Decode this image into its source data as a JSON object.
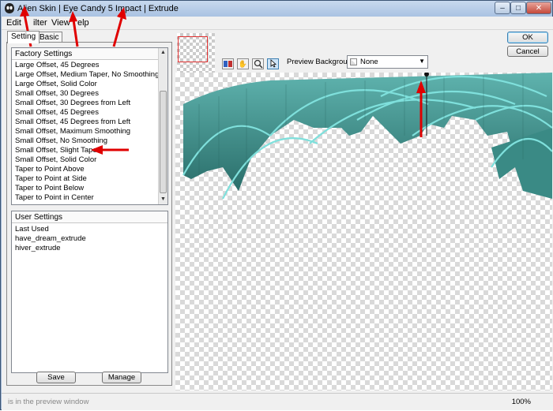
{
  "window": {
    "title": "Alien Skin | Eye Candy 5 Impact | Extrude",
    "controls": {
      "minimize": "–",
      "maximize": "□",
      "close": "✕"
    }
  },
  "menu": {
    "items": [
      {
        "label": "Edit"
      },
      {
        "label": "ilter"
      },
      {
        "label": "View"
      },
      {
        "label": "elp"
      }
    ]
  },
  "tabs": {
    "settings": "Setting",
    "basic": "Basic"
  },
  "factory": {
    "header": "Factory Settings",
    "items": [
      "Large Offset, 45 Degrees",
      "Large Offset, Medium Taper, No Smoothing",
      "Large Offset, Solid Color",
      "Small Offset, 30 Degrees",
      "Small Offset, 30 Degrees from Left",
      "Small Offset, 45 Degrees",
      "Small Offset, 45 Degrees from Left",
      "Small Offset, Maximum Smoothing",
      "Small Offset, No Smoothing",
      "Small Offset, Slight Taper",
      "Small Offset, Solid Color",
      "Taper to Point Above",
      "Taper to Point at Side",
      "Taper to Point Below",
      "Taper to Point in Center"
    ]
  },
  "user": {
    "header": "User Settings",
    "items": [
      "Last Used",
      "have_dream_extrude",
      "hiver_extrude"
    ]
  },
  "buttons": {
    "save": "Save",
    "manage": "Manage",
    "ok": "OK",
    "cancel": "Cancel"
  },
  "preview_background": {
    "label": "Preview Background:",
    "value": "None"
  },
  "status": {
    "text": "is in the preview window",
    "zoom": "100%"
  },
  "icons": [
    "app-icon",
    "preview-toggle-icon",
    "hand-pan-icon",
    "zoom-icon",
    "arrow-select-icon",
    "chevron-down-icon"
  ],
  "colors": {
    "extrude_dark": "#2f7f7a",
    "extrude_light": "#6fd0cc",
    "annotation_arrow": "#e00000"
  }
}
